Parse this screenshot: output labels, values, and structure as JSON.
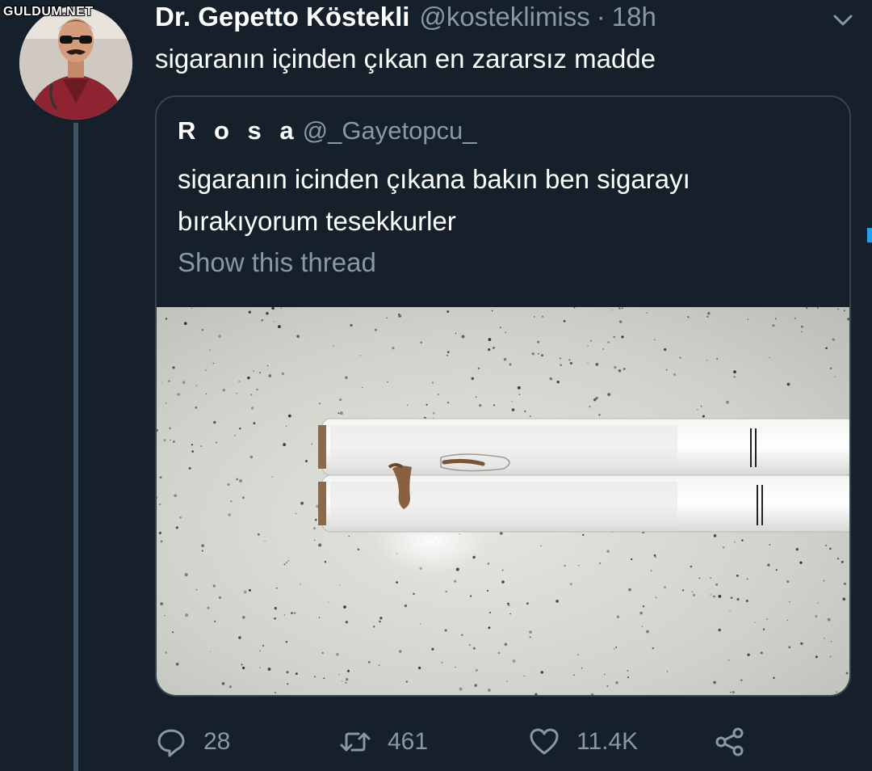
{
  "watermark": "GULDUM.NET",
  "tweet": {
    "display_name": "Dr. Gepetto Köstekli",
    "handle": "@kosteklimiss",
    "separator": "·",
    "time": "18h",
    "text": "sigaranın içinden çıkan en zararsız madde"
  },
  "quoted_tweet": {
    "display_name": "R o s a",
    "handle": "@_Gayetopcu_",
    "text": "sigaranın icinden çıkana bakın ben sigarayı bırakıyorum tesekkurler",
    "show_thread": "Show this thread"
  },
  "actions": {
    "replies": "28",
    "retweets": "461",
    "likes": "11.4K"
  },
  "icons": {
    "reply": "reply-icon",
    "retweet": "retweet-icon",
    "like": "heart-icon",
    "share": "share-icon",
    "menu": "chevron-down-icon"
  },
  "colors": {
    "background": "#15202b",
    "text_primary": "#ffffff",
    "text_secondary": "#8899a6",
    "border": "#38444d",
    "accent": "#1da1f2"
  }
}
